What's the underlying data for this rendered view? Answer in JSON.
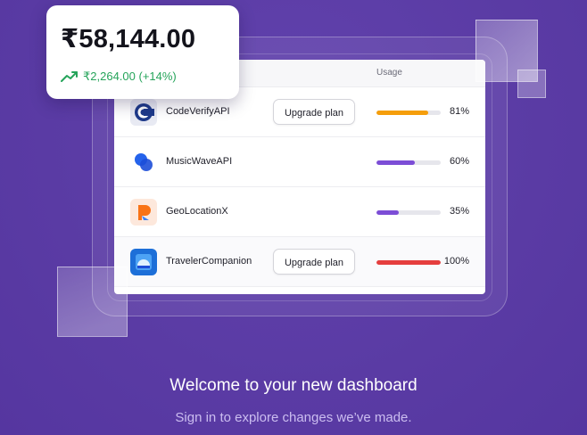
{
  "balance": {
    "amount": "₹58,144.00",
    "change": "₹2,264.00 (+14%)",
    "trend_icon": "trending-up-icon",
    "trend_color": "#25a45a"
  },
  "table": {
    "usage_header": "Usage",
    "rows": [
      {
        "name": "CodeVerifyAPI",
        "action": "Upgrade plan",
        "usage": 0.81,
        "usage_label": "81%",
        "bar_color": "#f59e0b",
        "logo": "codeverify-logo"
      },
      {
        "name": "MusicWaveAPI",
        "action": "",
        "usage": 0.6,
        "usage_label": "60%",
        "bar_color": "#7c4dd6",
        "logo": "musicwave-logo"
      },
      {
        "name": "GeoLocationX",
        "action": "",
        "usage": 0.35,
        "usage_label": "35%",
        "bar_color": "#7c4dd6",
        "logo": "geolocation-logo"
      },
      {
        "name": "TravelerCompanion",
        "action": "Upgrade plan",
        "usage": 1.0,
        "usage_label": "100%",
        "bar_color": "#e53e3e",
        "logo": "travelercompanion-logo"
      }
    ]
  },
  "welcome": {
    "title": "Welcome to your new dashboard",
    "subtitle": "Sign in to explore changes we’ve made."
  },
  "colors": {
    "background": "#5b3ca6",
    "accent_purple": "#7c4dd6"
  }
}
